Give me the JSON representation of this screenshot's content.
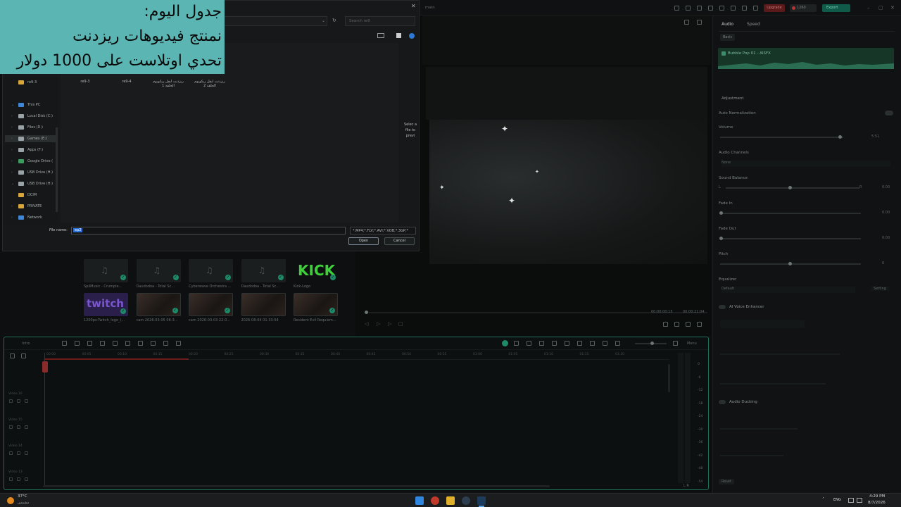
{
  "overlay": {
    "line1": "جدول اليوم:",
    "line2": "نمنتج فيديوهات ريزدنت",
    "line3": "تحدي اوتلاست على 1000 دولار"
  },
  "app": {
    "title": "main",
    "upgrade": "Upgrade",
    "credits": "1260",
    "export": "Export"
  },
  "dialog": {
    "search_placeholder": "Search re9",
    "nav_items": [
      {
        "label": "re9-3",
        "icon": "folder-icon",
        "color": "#d9a63a"
      },
      {
        "label": "This PC",
        "icon": "pc-icon",
        "color": "#3f86d9"
      },
      {
        "label": "Local Disk (C:)",
        "icon": "drive-icon",
        "color": "#9aa3a8"
      },
      {
        "label": "Files (D:)",
        "icon": "drive-icon",
        "color": "#9aa3a8"
      },
      {
        "label": "Games (E:)",
        "icon": "drive-icon",
        "color": "#9aa3a8"
      },
      {
        "label": "Apps (F:)",
        "icon": "drive-icon",
        "color": "#9aa3a8"
      },
      {
        "label": "Google Drive (",
        "icon": "gdrive-icon",
        "color": "#3a9d5d"
      },
      {
        "label": "USB Drive (H:)",
        "icon": "usb-icon",
        "color": "#9aa3a8"
      },
      {
        "label": "USB Drive (H:)",
        "icon": "usb-icon",
        "color": "#9aa3a8"
      },
      {
        "label": "DCIM",
        "icon": "folder-icon",
        "color": "#d9a63a"
      },
      {
        "label": "PRIVATE",
        "icon": "folder-icon",
        "color": "#d9a63a"
      },
      {
        "label": "Network",
        "icon": "network-icon",
        "color": "#3f86d9"
      }
    ],
    "files": [
      "re9-3",
      "re9-4",
      "ريزدنت ايفل ريكويوم الحلقة 1",
      "ريزدنت ايفل ريكويوم الحلقة 2"
    ],
    "preview_hint": "Selec a file to previ",
    "filename_label": "File name:",
    "filename_value": "ep2",
    "filetype": "*.MP4;*.FLV;*.AVI;*.VOB;*.3GP;*",
    "open": "Open",
    "cancel": "Cancel"
  },
  "media": {
    "items": [
      {
        "label": "SpilMusic - Crumple...",
        "kind": "audio"
      },
      {
        "label": "Daudodoa - Total Sc...",
        "kind": "audio"
      },
      {
        "label": "Cyberwave Orchestra ...",
        "kind": "audio"
      },
      {
        "label": "Daudodoa - Total Sc...",
        "kind": "audio"
      },
      {
        "label": "Kick-Logo",
        "kind": "kick",
        "logo": "KICK"
      },
      {
        "label": "1200px-Twitch_logo_(...",
        "kind": "twitch",
        "logo": "twitch"
      },
      {
        "label": "cam 2026-03-05 06-3...",
        "kind": "video"
      },
      {
        "label": "cam 2026-03-03 22-0...",
        "kind": "video"
      },
      {
        "label": "2026-08-04 01-33-54",
        "kind": "video"
      },
      {
        "label": "Resident Evil Requiem...",
        "kind": "video"
      }
    ]
  },
  "player": {
    "time_current": "00:00:00:15",
    "time_total": "00:00:21:04"
  },
  "right_panel": {
    "tabs": [
      "Audio",
      "Speed"
    ],
    "subtab": "Basic",
    "clip_name": "Bubble Pop 01 - AISFX",
    "section_adjustment": "Adjustment",
    "auto_normalization": "Auto Normalization",
    "volume": "Volume",
    "volume_value": "5.51",
    "audio_channels": "Audio Channels",
    "audio_channels_value": "None",
    "sound_balance": "Sound Balance",
    "balance_l": "L",
    "balance_r": "R",
    "balance_value": "0.00",
    "fade_in": "Fade In",
    "fade_in_value": "0.00",
    "fade_out": "Fade Out",
    "fade_out_value": "0.00",
    "pitch": "Pitch",
    "pitch_value": "0",
    "equalizer": "Equalizer",
    "equalizer_value": "Default",
    "equalizer_setting": "Setting",
    "ai_voice_enhancer": "AI Voice Enhancer",
    "audio_ducking": "Audio Ducking",
    "reset": "Reset"
  },
  "timeline": {
    "label": "Menu",
    "project": "Intro",
    "ruler": [
      "00:00",
      "00:05",
      "00:10",
      "00:15",
      "00:20",
      "00:25",
      "00:30",
      "00:35",
      "00:40",
      "00:45",
      "00:50",
      "00:55",
      "01:00",
      "01:05",
      "01:10",
      "01:15",
      "01:20"
    ],
    "tracks": [
      "Video 16",
      "Video 15",
      "Video 14",
      "Video 13"
    ],
    "meter_labels": [
      "0",
      "-6",
      "-12",
      "-18",
      "-24",
      "-30",
      "-36",
      "-42",
      "-48",
      "-54"
    ],
    "meter_lr": "L  R"
  },
  "taskbar": {
    "weather_temp": "37°C",
    "weather_desc": "مشمس",
    "lang": "ENG",
    "time": "4:29 PM",
    "date": "8/7/2026"
  }
}
